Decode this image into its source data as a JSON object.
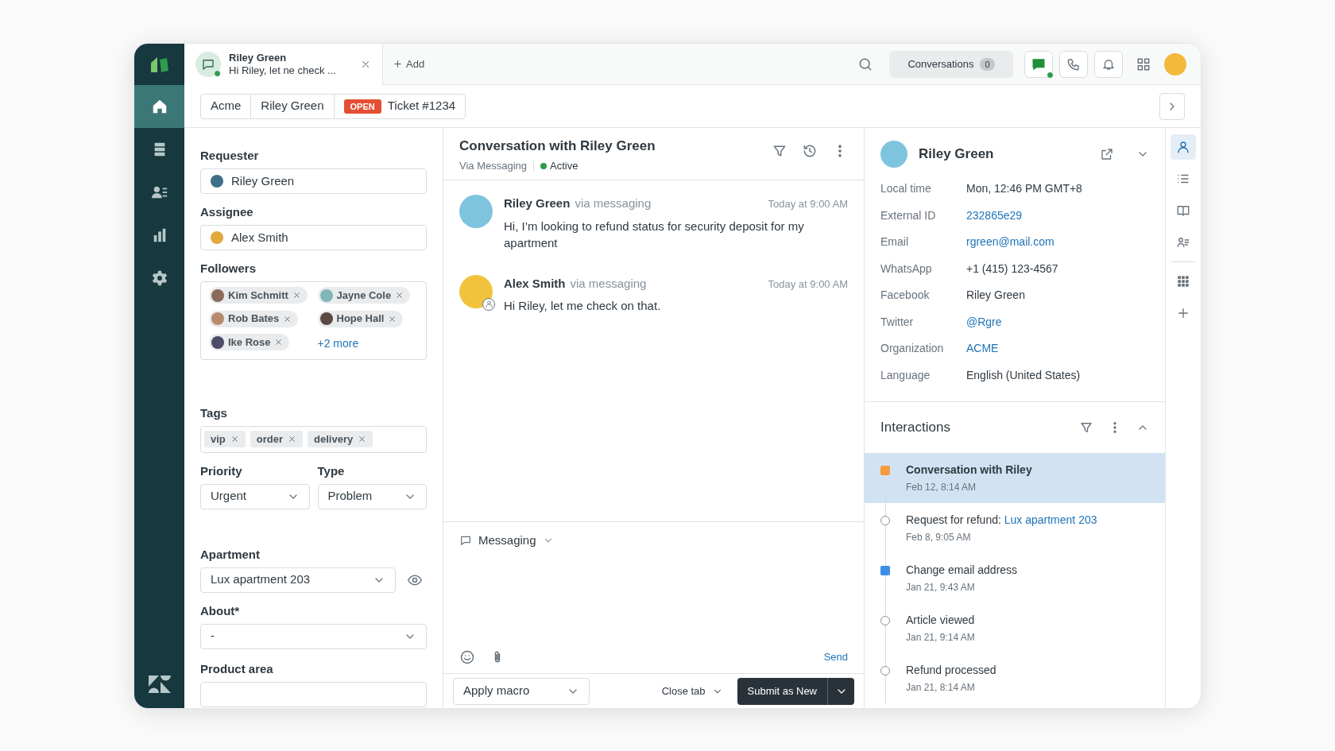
{
  "nav": {
    "items": [
      {
        "kind": "home",
        "selected": true
      },
      {
        "kind": "views",
        "selected": false
      },
      {
        "kind": "customers",
        "selected": false
      },
      {
        "kind": "reports",
        "selected": false
      },
      {
        "kind": "settings",
        "selected": false
      }
    ]
  },
  "top_bar": {
    "tabs": [
      {
        "title": "Riley Green",
        "preview": "Hi Riley, let ne check ...",
        "selected": true
      }
    ],
    "add": "Add",
    "conversations": {
      "label": "Conversations",
      "count": "0"
    }
  },
  "breadcrumbs": [
    {
      "label": "Acme"
    },
    {
      "label": "Riley Green"
    },
    {
      "badge": "OPEN",
      "label": "Ticket #1234"
    }
  ],
  "ticket_fields": {
    "requester": {
      "label": "Requester",
      "value": "Riley Green"
    },
    "assignee": {
      "label": "Assignee",
      "value": "Alex Smith"
    },
    "followers": {
      "label": "Followers",
      "people": [
        "Kim Schmitt",
        "Jayne Cole",
        "Rob Bates",
        "Hope Hall",
        "Ike Rose"
      ],
      "more": "+2 more"
    },
    "tags": {
      "label": "Tags",
      "items": [
        "vip",
        "order",
        "delivery"
      ]
    },
    "priority": {
      "label": "Priority",
      "value": "Urgent"
    },
    "type": {
      "label": "Type",
      "value": "Problem"
    },
    "apartment": {
      "label": "Apartment",
      "value": "Lux apartment 203"
    },
    "about": {
      "label": "About*",
      "value": "-"
    },
    "product_area": {
      "label": "Product area"
    }
  },
  "conversation": {
    "title": "Conversation with Riley Green",
    "channel": "Via Messaging",
    "status": "Active",
    "messages": [
      {
        "author": "Riley Green",
        "via": "via messaging",
        "time": "Today at 9:00 AM",
        "text": "Hi, I’m looking to refund status for security deposit for my apartment",
        "agent": false
      },
      {
        "author": "Alex Smith",
        "via": "via messaging",
        "time": "Today at 9:00 AM",
        "text": "Hi Riley, let me check on that.",
        "agent": true
      }
    ],
    "composer": {
      "channel": "Messaging",
      "send": "Send"
    },
    "footer": {
      "macro": "Apply macro",
      "close": "Close tab",
      "submit": "Submit as New"
    }
  },
  "profile": {
    "name": "Riley Green",
    "fields": [
      {
        "label": "Local time",
        "value": "Mon, 12:46 PM GMT+8",
        "link": false
      },
      {
        "label": "External ID",
        "value": "232865e29",
        "link": true
      },
      {
        "label": "Email",
        "value": "rgreen@mail.com",
        "link": true
      },
      {
        "label": "WhatsApp",
        "value": "+1 (415) 123-4567",
        "link": false
      },
      {
        "label": "Facebook",
        "value": "Riley Green",
        "link": false
      },
      {
        "label": "Twitter",
        "value": "@Rgre",
        "link": true
      },
      {
        "label": "Organization",
        "value": "ACME",
        "link": true
      },
      {
        "label": "Language",
        "value": "English (United States)",
        "link": false
      }
    ],
    "interactions": {
      "title": "Interactions",
      "items": [
        {
          "kind": "square",
          "color": "#f79a3e",
          "title": "Conversation with Riley",
          "date": "Feb 12, 8:14 AM",
          "selected": true
        },
        {
          "kind": "circle",
          "title": "Request for refund: ",
          "link": "Lux apartment 203",
          "date": "Feb 8, 9:05 AM",
          "selected": false
        },
        {
          "kind": "square",
          "color": "#3b8fe8",
          "title": "Change email address",
          "date": "Jan 21, 9:43 AM",
          "selected": false
        },
        {
          "kind": "circle",
          "title": "Article viewed",
          "date": "Jan 21, 9:14 AM",
          "selected": false
        },
        {
          "kind": "circle",
          "title": "Refund processed",
          "date": "Jan 21, 8:14 AM",
          "selected": false
        }
      ]
    }
  },
  "rail": {
    "items": [
      {
        "kind": "user",
        "selected": true
      },
      {
        "kind": "list",
        "selected": false
      },
      {
        "kind": "book",
        "selected": false
      },
      {
        "kind": "contacts",
        "selected": false
      },
      {
        "kind": "apps",
        "selected": false
      },
      {
        "kind": "add",
        "selected": false
      }
    ]
  }
}
